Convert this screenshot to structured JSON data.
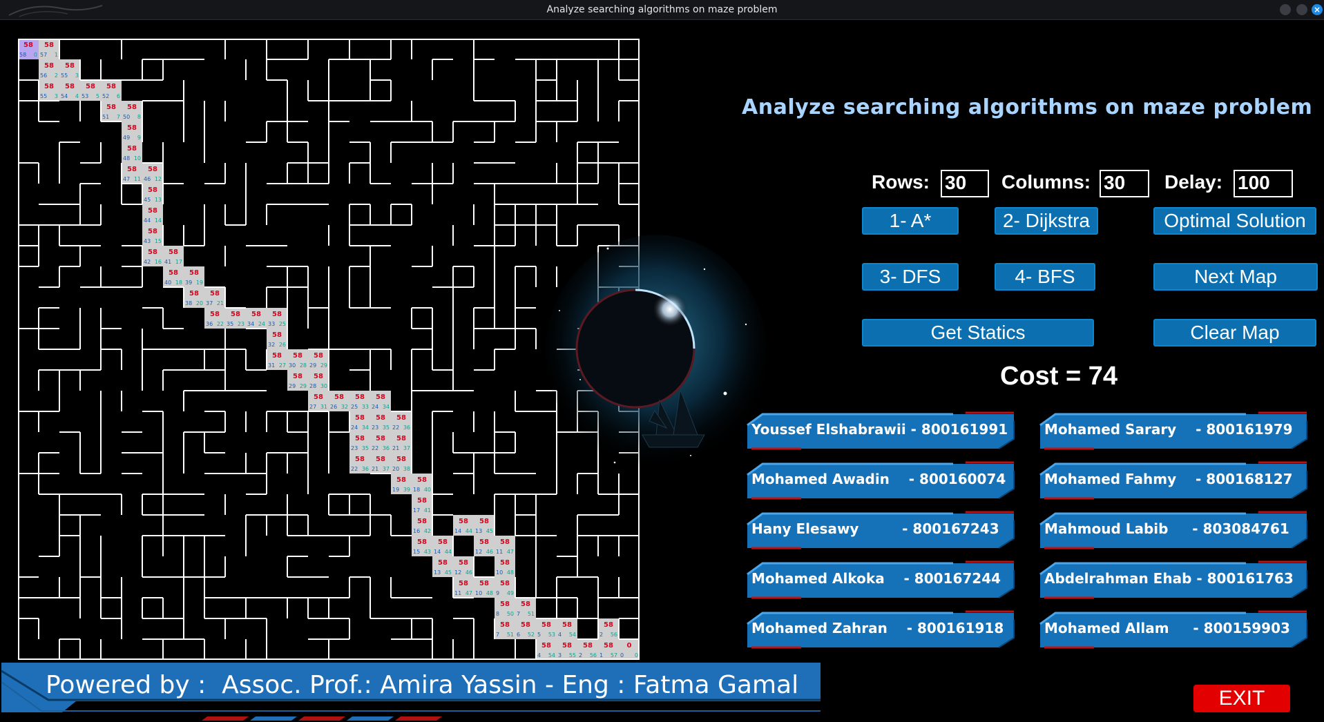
{
  "window": {
    "title": "Analyze searching algorithms on maze problem"
  },
  "app": {
    "heading": "Analyze searching algorithms on maze problem"
  },
  "params": {
    "rows_label": "Rows:",
    "rows_value": "30",
    "columns_label": "Columns:",
    "columns_value": "30",
    "delay_label": "Delay:",
    "delay_value": "100"
  },
  "buttons": {
    "astar": "1- A*",
    "dijkstra": "2- Dijkstra",
    "optimal": "Optimal Solution",
    "dfs": "3- DFS",
    "bfs": "4- BFS",
    "next_map": "Next Map",
    "get_statics": "Get Statics",
    "clear_map": "Clear Map",
    "exit": "EXIT"
  },
  "result": {
    "cost_text": "Cost = 74"
  },
  "team": [
    {
      "text": "Youssef Elshabrawii - 800161991"
    },
    {
      "text": "Mohamed Sarary    - 800161979"
    },
    {
      "text": "Mohamed Awadin    - 800160074"
    },
    {
      "text": "Mohamed Fahmy    - 800168127"
    },
    {
      "text": "Hany Elesawy         - 800167243"
    },
    {
      "text": "Mahmoud Labib     - 803084761"
    },
    {
      "text": "Mohamed Alkoka    - 800167244"
    },
    {
      "text": "Abdelrahman Ehab - 800161763"
    },
    {
      "text": "Mohamed Zahran    - 800161918"
    },
    {
      "text": "Mohamed Allam     - 800159903"
    }
  ],
  "footer": {
    "credit": "Powered by :  Assoc. Prof.: Amira Yassin - Eng : Fatma Gamal"
  },
  "maze": {
    "rows": 30,
    "columns": 30,
    "path_top_label": "58",
    "path_cells": [
      {
        "r": 0,
        "c": 0,
        "g": 58,
        "h": 0,
        "start": true
      },
      {
        "r": 0,
        "c": 1,
        "g": 57,
        "h": 1
      },
      {
        "r": 1,
        "c": 1,
        "g": 56,
        "h": 2
      },
      {
        "r": 1,
        "c": 2,
        "g": 55,
        "h": 3
      },
      {
        "r": 2,
        "c": 1,
        "g": 55,
        "h": 3
      },
      {
        "r": 2,
        "c": 2,
        "g": 54,
        "h": 4
      },
      {
        "r": 2,
        "c": 3,
        "g": 53,
        "h": 5
      },
      {
        "r": 2,
        "c": 4,
        "g": 52,
        "h": 6
      },
      {
        "r": 3,
        "c": 4,
        "g": 51,
        "h": 7
      },
      {
        "r": 3,
        "c": 5,
        "g": 50,
        "h": 8
      },
      {
        "r": 4,
        "c": 5,
        "g": 49,
        "h": 9
      },
      {
        "r": 5,
        "c": 5,
        "g": 48,
        "h": 10
      },
      {
        "r": 6,
        "c": 5,
        "g": 47,
        "h": 11
      },
      {
        "r": 6,
        "c": 6,
        "g": 46,
        "h": 12
      },
      {
        "r": 7,
        "c": 6,
        "g": 45,
        "h": 13
      },
      {
        "r": 8,
        "c": 6,
        "g": 44,
        "h": 14
      },
      {
        "r": 9,
        "c": 6,
        "g": 43,
        "h": 15
      },
      {
        "r": 10,
        "c": 6,
        "g": 42,
        "h": 16
      },
      {
        "r": 10,
        "c": 7,
        "g": 41,
        "h": 17
      },
      {
        "r": 11,
        "c": 7,
        "g": 40,
        "h": 18
      },
      {
        "r": 11,
        "c": 8,
        "g": 39,
        "h": 19
      },
      {
        "r": 12,
        "c": 8,
        "g": 38,
        "h": 20
      },
      {
        "r": 12,
        "c": 9,
        "g": 37,
        "h": 21
      },
      {
        "r": 13,
        "c": 9,
        "g": 36,
        "h": 22
      },
      {
        "r": 13,
        "c": 10,
        "g": 35,
        "h": 23
      },
      {
        "r": 13,
        "c": 11,
        "g": 34,
        "h": 24
      },
      {
        "r": 13,
        "c": 12,
        "g": 33,
        "h": 25
      },
      {
        "r": 14,
        "c": 12,
        "g": 32,
        "h": 26
      },
      {
        "r": 15,
        "c": 12,
        "g": 31,
        "h": 27
      },
      {
        "r": 15,
        "c": 13,
        "g": 30,
        "h": 28
      },
      {
        "r": 15,
        "c": 14,
        "g": 29,
        "h": 29
      },
      {
        "r": 16,
        "c": 13,
        "g": 29,
        "h": 29
      },
      {
        "r": 16,
        "c": 14,
        "g": 28,
        "h": 30
      },
      {
        "r": 17,
        "c": 14,
        "g": 27,
        "h": 31
      },
      {
        "r": 17,
        "c": 15,
        "g": 26,
        "h": 32
      },
      {
        "r": 17,
        "c": 16,
        "g": 25,
        "h": 33
      },
      {
        "r": 17,
        "c": 17,
        "g": 24,
        "h": 34
      },
      {
        "r": 18,
        "c": 16,
        "g": 24,
        "h": 34
      },
      {
        "r": 18,
        "c": 17,
        "g": 23,
        "h": 35
      },
      {
        "r": 18,
        "c": 18,
        "g": 22,
        "h": 36
      },
      {
        "r": 19,
        "c": 16,
        "g": 23,
        "h": 35
      },
      {
        "r": 19,
        "c": 17,
        "g": 22,
        "h": 36
      },
      {
        "r": 19,
        "c": 18,
        "g": 21,
        "h": 37
      },
      {
        "r": 20,
        "c": 16,
        "g": 22,
        "h": 36
      },
      {
        "r": 20,
        "c": 17,
        "g": 21,
        "h": 37
      },
      {
        "r": 20,
        "c": 18,
        "g": 20,
        "h": 38
      },
      {
        "r": 21,
        "c": 18,
        "g": 19,
        "h": 39
      },
      {
        "r": 21,
        "c": 19,
        "g": 18,
        "h": 40
      },
      {
        "r": 22,
        "c": 19,
        "g": 17,
        "h": 41
      },
      {
        "r": 23,
        "c": 19,
        "g": 16,
        "h": 42
      },
      {
        "r": 23,
        "c": 21,
        "g": 14,
        "h": 44
      },
      {
        "r": 23,
        "c": 22,
        "g": 13,
        "h": 45
      },
      {
        "r": 24,
        "c": 19,
        "g": 15,
        "h": 43
      },
      {
        "r": 24,
        "c": 20,
        "g": 14,
        "h": 44
      },
      {
        "r": 24,
        "c": 22,
        "g": 12,
        "h": 46
      },
      {
        "r": 24,
        "c": 23,
        "g": 11,
        "h": 47
      },
      {
        "r": 25,
        "c": 20,
        "g": 13,
        "h": 45
      },
      {
        "r": 25,
        "c": 21,
        "g": 12,
        "h": 46
      },
      {
        "r": 25,
        "c": 23,
        "g": 10,
        "h": 48
      },
      {
        "r": 26,
        "c": 21,
        "g": 11,
        "h": 47
      },
      {
        "r": 26,
        "c": 22,
        "g": 10,
        "h": 48
      },
      {
        "r": 26,
        "c": 23,
        "g": 9,
        "h": 49
      },
      {
        "r": 27,
        "c": 23,
        "g": 8,
        "h": 50
      },
      {
        "r": 27,
        "c": 24,
        "g": 7,
        "h": 51
      },
      {
        "r": 28,
        "c": 23,
        "g": 7,
        "h": 51
      },
      {
        "r": 28,
        "c": 24,
        "g": 6,
        "h": 52
      },
      {
        "r": 28,
        "c": 25,
        "g": 5,
        "h": 53
      },
      {
        "r": 28,
        "c": 26,
        "g": 4,
        "h": 54
      },
      {
        "r": 28,
        "c": 28,
        "g": 2,
        "h": 56
      },
      {
        "r": 29,
        "c": 25,
        "g": 4,
        "h": 54
      },
      {
        "r": 29,
        "c": 26,
        "g": 3,
        "h": 55
      },
      {
        "r": 29,
        "c": 27,
        "g": 2,
        "h": 56
      },
      {
        "r": 29,
        "c": 28,
        "g": 1,
        "h": 57
      },
      {
        "r": 29,
        "c": 29,
        "g": 0,
        "h": 0,
        "goal": true
      }
    ]
  },
  "colors": {
    "accent": "#0b6fb0",
    "heading": "#a8d4ff",
    "exit": "#e30000",
    "path_fill": "#cfcfcf",
    "path_top": "#e0001b",
    "path_g": "#1e5aa8",
    "path_h": "#10a090",
    "start_fill": "#b9a6f0"
  }
}
